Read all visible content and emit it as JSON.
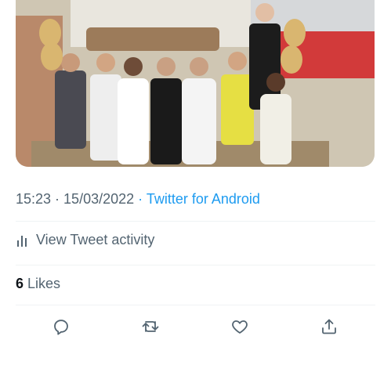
{
  "tweet": {
    "media": {
      "image_description_icon": "photo"
    },
    "meta": {
      "time": "15:23",
      "sep1": " · ",
      "date": "15/03/2022",
      "sep2": " · ",
      "source": "Twitter for Android"
    },
    "activity": {
      "label": "View Tweet activity",
      "icon": "chart-bars-icon"
    },
    "likes": {
      "count": "6",
      "label": " Likes"
    },
    "actions": [
      {
        "name": "reply",
        "icon": "reply-icon"
      },
      {
        "name": "retweet",
        "icon": "retweet-icon"
      },
      {
        "name": "like",
        "icon": "heart-icon"
      },
      {
        "name": "share",
        "icon": "share-icon"
      }
    ]
  },
  "colors": {
    "text_secondary": "#536471",
    "link": "#1d9bf0",
    "divider": "#eff3f4"
  }
}
